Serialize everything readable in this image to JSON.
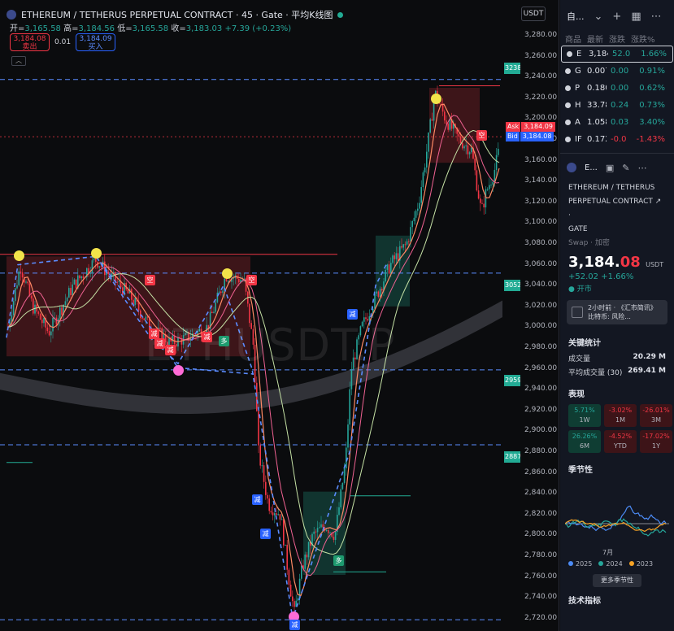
{
  "chart": {
    "title": "ETHEREUM / TETHERUS PERPETUAL CONTRACT · 45 · Gate · 平均K线图",
    "ohlc": {
      "o_label": "开=",
      "o": "3,165.58",
      "h_label": "高=",
      "h": "3,184.56",
      "l_label": "低=",
      "l": "3,165.58",
      "c_label": "收=",
      "c": "3,183.03",
      "change": "+7.39 (+0.23%)"
    },
    "sell": {
      "price": "3,184.08",
      "label": "卖出"
    },
    "spread": "0.01",
    "buy": {
      "price": "3,184.09",
      "label": "买入"
    },
    "currency_box": "USDT",
    "watermark": "ETHUSDT.P",
    "ask_label": "Ask",
    "ask_value": "3,184.09",
    "bid_label": "Bid",
    "bid_value": "3,184.08",
    "level_tags": [
      "3238",
      "3052",
      "2959",
      "2887"
    ],
    "price_labels": [
      "3,280.00",
      "3,260.00",
      "3,240.00",
      "3,220.00",
      "3,200.00",
      "3,180.00",
      "3,160.00",
      "3,140.00",
      "3,120.00",
      "3,100.00",
      "3,080.00",
      "3,060.00",
      "3,040.00",
      "3,020.00",
      "3,000.00",
      "2,980.00",
      "2,960.00",
      "2,940.00",
      "2,920.00",
      "2,900.00",
      "2,880.00",
      "2,860.00",
      "2,840.00",
      "2,820.00",
      "2,800.00",
      "2,780.00",
      "2,760.00",
      "2,740.00",
      "2,720.00"
    ],
    "markers": {
      "sell": "空",
      "reduce": "减",
      "long": "多"
    },
    "colors": {
      "up": "#26a69a",
      "down": "#f23645",
      "blue": "#2962ff",
      "accent_green": "#22ab94"
    }
  },
  "sidebar": {
    "header_title": "自...",
    "watchlist_cols": [
      "商品",
      "最新",
      "涨跌",
      "涨跌%"
    ],
    "watchlist": [
      {
        "sym": "E",
        "last": "3,184",
        "chg": "52.0",
        "pct": "1.66%",
        "dir": "up"
      },
      {
        "sym": "G",
        "last": "0.007",
        "chg": "0.00",
        "pct": "0.91%",
        "dir": "up"
      },
      {
        "sym": "P",
        "last": "0.180",
        "chg": "0.00",
        "pct": "0.62%",
        "dir": "up"
      },
      {
        "sym": "H",
        "last": "33.78",
        "chg": "0.24",
        "pct": "0.73%",
        "dir": "up"
      },
      {
        "sym": "A",
        "last": "1.058",
        "chg": "0.03",
        "pct": "3.40%",
        "dir": "up"
      },
      {
        "sym": "IF",
        "last": "0.172",
        "chg": "-0.0",
        "pct": "-1.43%",
        "dir": "dn"
      }
    ],
    "detail_sym": "E...",
    "name_line1": "ETHEREUM / TETHERUS",
    "name_line2": "PERPETUAL CONTRACT",
    "name_line3": "GATE",
    "sub": "Swap · 加密",
    "price_int": "3,184.",
    "price_dec": "08",
    "price_cur": "USDT",
    "change": "+52.02  +1.66%",
    "market_status": "开市",
    "news": "2小时前 · 《汇市简讯》比特币: 风险...",
    "stats_title": "关键统计",
    "stats": [
      {
        "k": "成交量",
        "v": "20.29 M"
      },
      {
        "k": "平均成交量 (30)",
        "v": "269.41 M"
      }
    ],
    "perf_title": "表现",
    "perf": [
      {
        "v": "5.71%",
        "l": "1W",
        "dir": "up"
      },
      {
        "v": "-3.02%",
        "l": "1M",
        "dir": "dn"
      },
      {
        "v": "-26.01%",
        "l": "3M",
        "dir": "dn"
      },
      {
        "v": "26.26%",
        "l": "6M",
        "dir": "up"
      },
      {
        "v": "-4.52%",
        "l": "YTD",
        "dir": "dn"
      },
      {
        "v": "-17.02%",
        "l": "1Y",
        "dir": "dn"
      }
    ],
    "season_title": "季节性",
    "season_month": "7月",
    "season_legend": [
      {
        "name": "2025",
        "color": "#4c8bf5"
      },
      {
        "name": "2024",
        "color": "#26a69a"
      },
      {
        "name": "2023",
        "color": "#f7a325"
      }
    ],
    "more_season": "更多季节性",
    "tech_title": "技术指标"
  }
}
